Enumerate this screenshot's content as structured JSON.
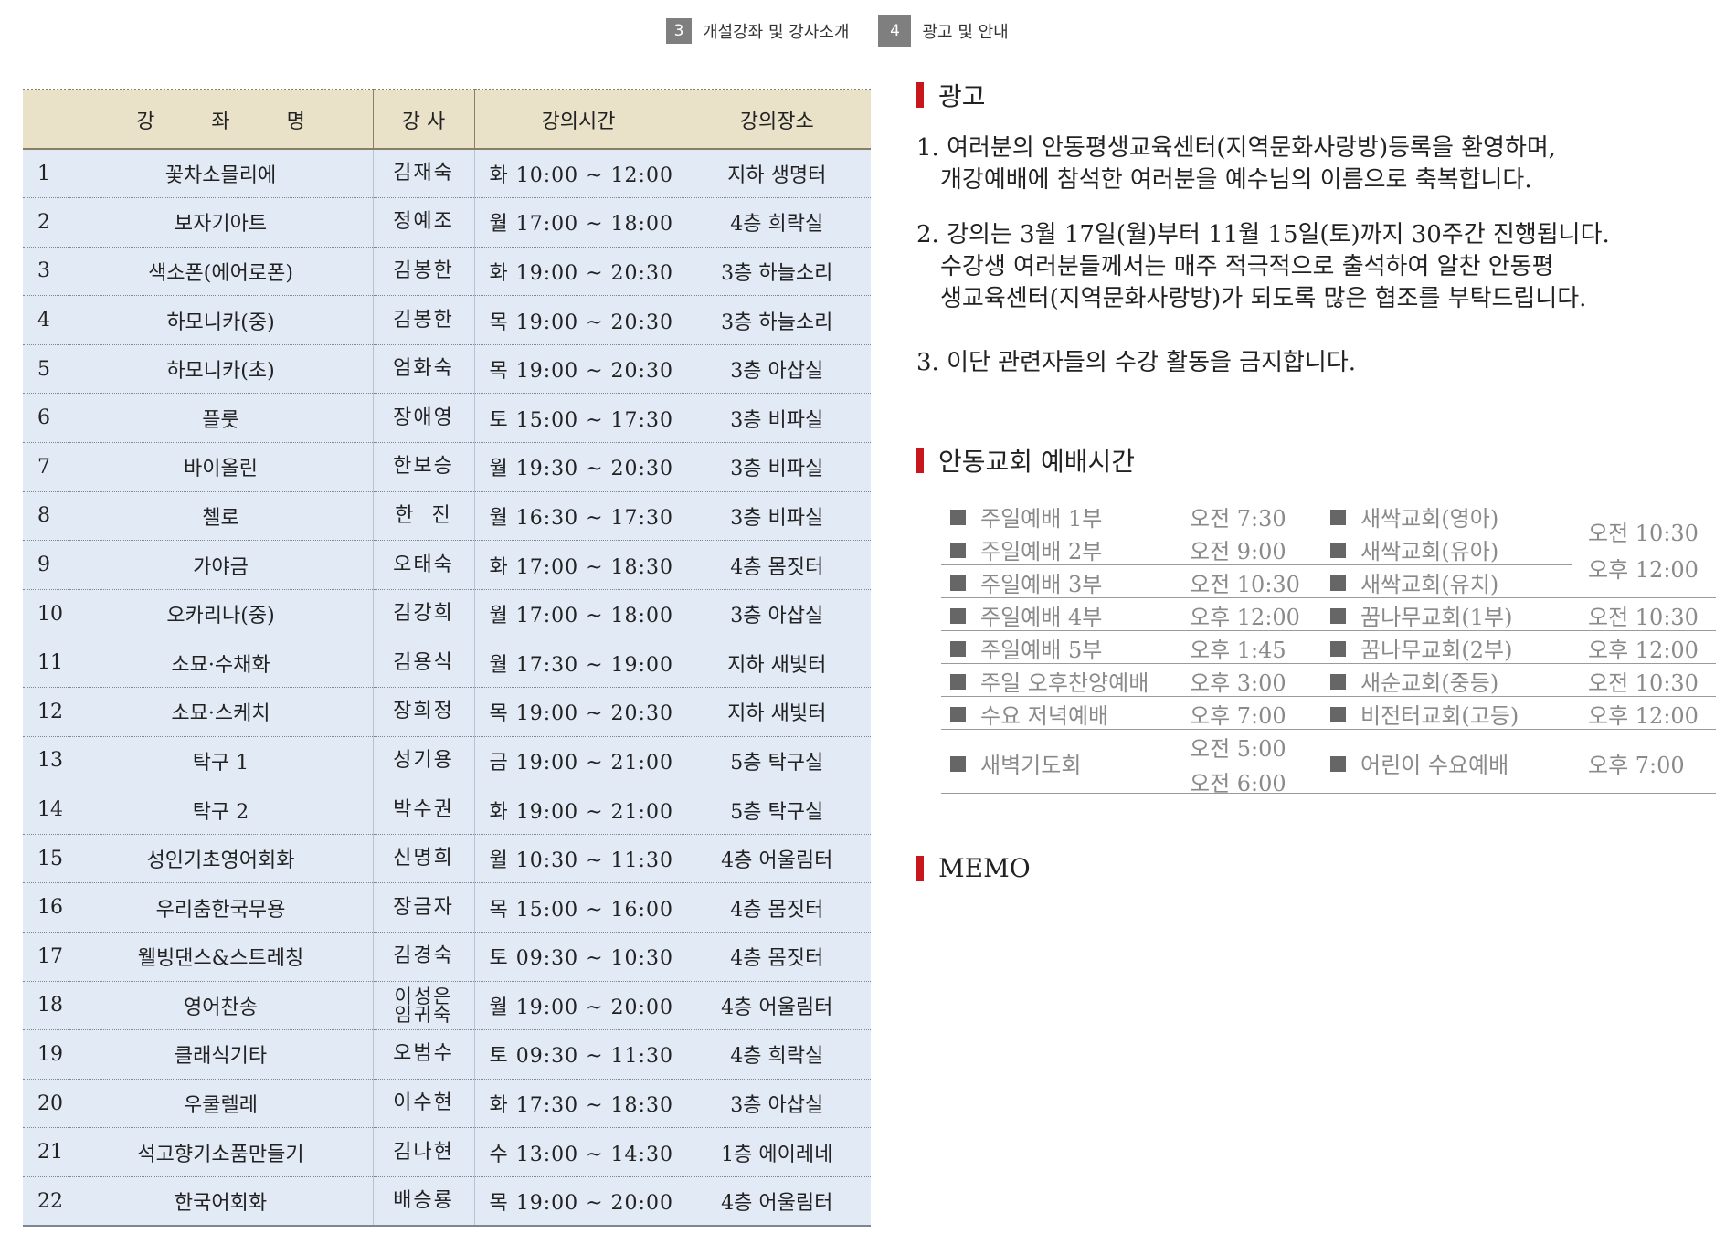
{
  "tabs": [
    {
      "number": "3",
      "label": "개설강좌 및 강사소개"
    },
    {
      "number": "4",
      "label": "광고 및 안내"
    }
  ],
  "course_table": {
    "headers": {
      "no": "",
      "name": "강  좌  명",
      "teacher": "강 사",
      "time": "강의시간",
      "place": "강의장소"
    },
    "rows": [
      {
        "no": "1",
        "name": "꽃차소믈리에",
        "teacher": "김재숙",
        "time": "화 10:00 ~ 12:00",
        "place": "지하 생명터"
      },
      {
        "no": "2",
        "name": "보자기아트",
        "teacher": "정예조",
        "time": "월 17:00 ~ 18:00",
        "place": "4층 희락실"
      },
      {
        "no": "3",
        "name": "색소폰(에어로폰)",
        "teacher": "김봉한",
        "time": "화 19:00 ~ 20:30",
        "place": "3층 하늘소리"
      },
      {
        "no": "4",
        "name": "하모니카(중)",
        "teacher": "김봉한",
        "time": "목 19:00 ~ 20:30",
        "place": "3층 하늘소리"
      },
      {
        "no": "5",
        "name": "하모니카(초)",
        "teacher": "엄화숙",
        "time": "목 19:00 ~ 20:30",
        "place": "3층 아삽실"
      },
      {
        "no": "6",
        "name": "플룻",
        "teacher": "장애영",
        "time": "토 15:00 ~ 17:30",
        "place": "3층 비파실"
      },
      {
        "no": "7",
        "name": "바이올린",
        "teacher": "한보승",
        "time": "월 19:30 ~ 20:30",
        "place": "3층 비파실"
      },
      {
        "no": "8",
        "name": "첼로",
        "teacher": "한  진",
        "time": "월 16:30 ~ 17:30",
        "place": "3층 비파실"
      },
      {
        "no": "9",
        "name": "가야금",
        "teacher": "오태숙",
        "time": "화 17:00 ~ 18:30",
        "place": "4층 몸짓터"
      },
      {
        "no": "10",
        "name": "오카리나(중)",
        "teacher": "김강희",
        "time": "월 17:00 ~ 18:00",
        "place": "3층 아삽실"
      },
      {
        "no": "11",
        "name": "소묘·수채화",
        "teacher": "김용식",
        "time": "월 17:30 ~ 19:00",
        "place": "지하 새빛터"
      },
      {
        "no": "12",
        "name": "소묘·스케치",
        "teacher": "장희정",
        "time": "목 19:00 ~ 20:30",
        "place": "지하 새빛터"
      },
      {
        "no": "13",
        "name": "탁구 1",
        "teacher": "성기용",
        "time": "금 19:00 ~ 21:00",
        "place": "5층 탁구실"
      },
      {
        "no": "14",
        "name": "탁구 2",
        "teacher": "박수권",
        "time": "화 19:00 ~ 21:00",
        "place": "5층 탁구실"
      },
      {
        "no": "15",
        "name": "성인기초영어회화",
        "teacher": "신명희",
        "time": "월 10:30 ~ 11:30",
        "place": "4층 어울림터"
      },
      {
        "no": "16",
        "name": "우리춤한국무용",
        "teacher": "장금자",
        "time": "목 15:00 ~ 16:00",
        "place": "4층 몸짓터"
      },
      {
        "no": "17",
        "name": "웰빙댄스&스트레칭",
        "teacher": "김경숙",
        "time": "토 09:30 ~ 10:30",
        "place": "4층 몸짓터"
      },
      {
        "no": "18",
        "name": "영어찬송",
        "teacher": "이성은",
        "teacher2": "임귀숙",
        "time": "월 19:00 ~ 20:00",
        "place": "4층 어울림터"
      },
      {
        "no": "19",
        "name": "클래식기타",
        "teacher": "오범수",
        "time": "토 09:30 ~ 11:30",
        "place": "4층 희락실"
      },
      {
        "no": "20",
        "name": "우쿨렐레",
        "teacher": "이수현",
        "time": "화 17:30 ~ 18:30",
        "place": "3층 아삽실"
      },
      {
        "no": "21",
        "name": "석고향기소품만들기",
        "teacher": "김나현",
        "time": "수 13:00 ~ 14:30",
        "place": "1층 에이레네"
      },
      {
        "no": "22",
        "name": "한국어회화",
        "teacher": "배승룡",
        "time": "목 19:00 ~ 20:00",
        "place": "4층 어울림터"
      }
    ]
  },
  "ad_section": {
    "title": "광고",
    "items": [
      {
        "line1": "1. 여러분의 안동평생교육센터(지역문화사랑방)등록을 환영하며,",
        "line2": "개강예배에 참석한 여러분을 예수님의 이름으로 축복합니다."
      },
      {
        "line1": "2. 강의는 3월 17일(월)부터 11월 15일(토)까지 30주간 진행됩니다.",
        "line2": "수강생 여러분들께서는 매주 적극적으로 출석하여 알찬 안동평",
        "line3": "생교육센터(지역문화사랑방)가 되도록 많은 협조를 부탁드립니다."
      },
      {
        "line1": "3. 이단 관련자들의 수강 활동을 금지합니다."
      }
    ]
  },
  "worship_section": {
    "title": "안동교회 예배시간",
    "rows": [
      {
        "left_name": "주일예배 1부",
        "left_time": "오전 7:30",
        "right_name": "새싹교회(영아)"
      },
      {
        "left_name": "주일예배 2부",
        "left_time": "오전 9:00",
        "right_name": "새싹교회(유아)"
      },
      {
        "left_name": "주일예배 3부",
        "left_time": "오전 10:30",
        "right_name": "새싹교회(유치)"
      },
      {
        "left_name": "주일예배 4부",
        "left_time": "오후 12:00",
        "right_name": "꿈나무교회(1부)",
        "right_time": "오전 10:30"
      },
      {
        "left_name": "주일예배 5부",
        "left_time": "오후 1:45",
        "right_name": "꿈나무교회(2부)",
        "right_time": "오후 12:00"
      },
      {
        "left_name": "주일 오후찬양예배",
        "left_time": "오후 3:00",
        "right_name": "새순교회(중등)",
        "right_time": "오전 10:30"
      },
      {
        "left_name": "수요 저녁예배",
        "left_time": "오후 7:00",
        "right_name": "비전터교회(고등)",
        "right_time": "오후 12:00"
      },
      {
        "left_name": "새벽기도회",
        "left_time": "오전 5:00",
        "left_time2": "오전 6:00",
        "right_name": "어린이 수요예배",
        "right_time": "오후 7:00"
      }
    ],
    "saessak_times": [
      "오전 10:30",
      "오후 12:00"
    ]
  },
  "memo_section": {
    "title": "MEMO"
  },
  "colors": {
    "accent_red": "#c8161d",
    "table_header_bg": "#e9e1c8",
    "table_body_bg": "#e2eaf5",
    "tab_bg": "#7f7f7f"
  }
}
